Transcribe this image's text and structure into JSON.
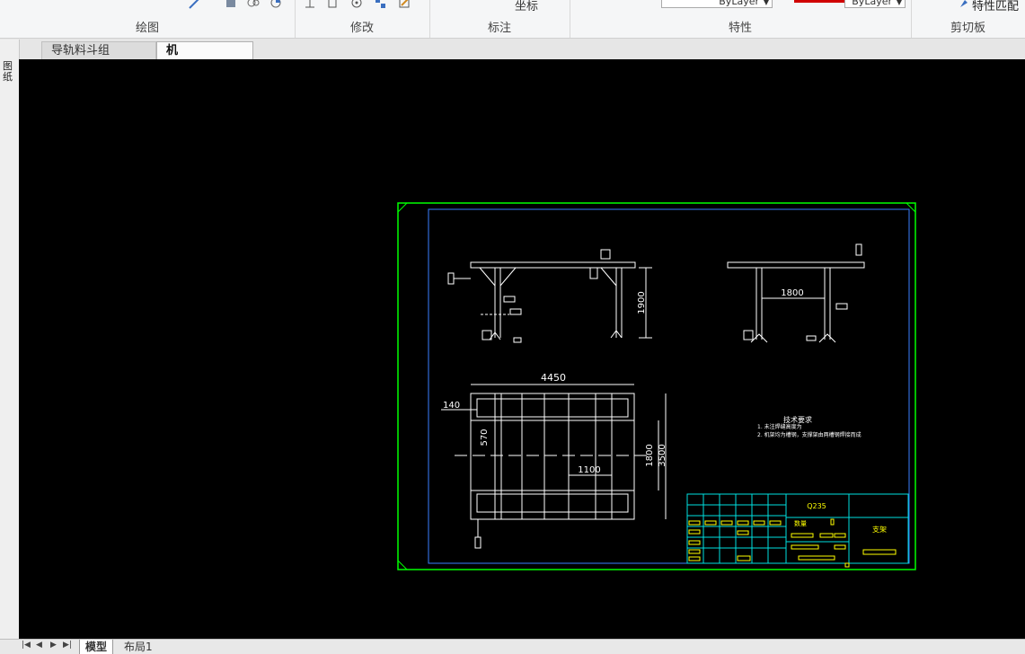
{
  "ribbon": {
    "groups": [
      {
        "label": "绘图"
      },
      {
        "label": "修改"
      },
      {
        "label": "标注"
      },
      {
        "label": "特性"
      },
      {
        "label": "剪切板"
      }
    ],
    "dimension_button": "坐标",
    "layer_combo_left": "ByLayer",
    "layer_combo_right": "ByLayer",
    "match_properties_button": "特性匹配"
  },
  "tabs": [
    {
      "label": "导轨料斗组装.dwg"
    },
    {
      "label": "机架.dwg*"
    }
  ],
  "sidebar": {
    "label": "图纸"
  },
  "layout_tabs": [
    {
      "label": "模型"
    },
    {
      "label": "布局1"
    }
  ],
  "drawing": {
    "dims": {
      "top_height": "1900",
      "top_span": "1800",
      "plan_width": "4450",
      "plan_left": "140",
      "plan_570": "570",
      "plan_1100": "1100",
      "plan_1800": "1800",
      "plan_3500": "3500"
    },
    "tech_title": "技术要求",
    "tech_lines": [
      "1. 未注焊缝高度为",
      "2. 机架均为槽钢，支撑架由两槽钢焊接而成"
    ],
    "title_block": {
      "material": "Q235",
      "qty_label": "数量",
      "name": "支架"
    }
  },
  "colors": {
    "canvas": "#000000",
    "frame": "#00ff00",
    "border": "#3a7fff",
    "title_text": "#ffff00",
    "cyan": "#00e0e0"
  }
}
